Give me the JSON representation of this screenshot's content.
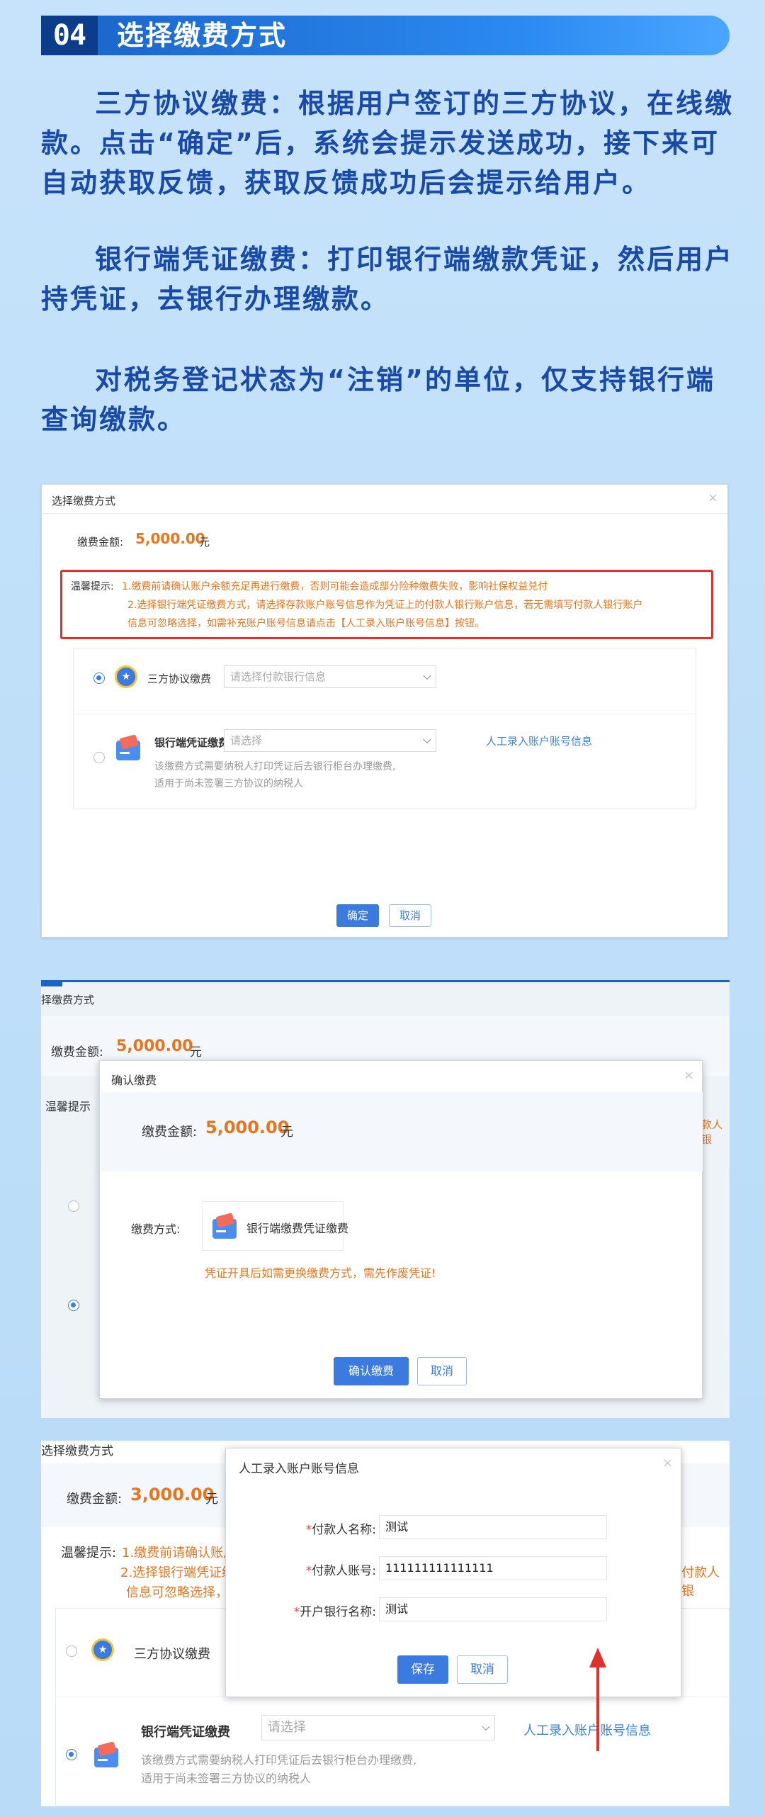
{
  "header": {
    "num": "04",
    "title": "选择缴费方式"
  },
  "paragraphs": [
    "三方协议缴费：根据用户签订的三方协议，在线缴款。点击“确定”后，系统会提示发送成功，接下来可自动获取反馈，获取反馈成功后会提示给用户。",
    "银行端凭证缴费：打印银行端缴款凭证，然后用户持凭证，去银行办理缴款。",
    "对税务登记状态为“注销”的单位，仅支持银行端查询缴款。"
  ],
  "shot1": {
    "title": "选择缴费方式",
    "amount_label": "缴费金额:",
    "amount": "5,000.00",
    "unit": "元",
    "tip_label": "温馨提示:",
    "tip1": "1.缴费前请确认账户余额充足再进行缴费，否则可能会造成部分险种缴费失败，影响社保权益兑付",
    "tip2": "2.选择银行端凭证缴费方式，请选择存款账户账号信息作为凭证上的付款人银行账户信息，若无需填写付款人银行账户",
    "tip3": "信息可忽略选择，如需补充账户账号信息请点击【人工录入账户账号信息】按钮。",
    "opt1_label": "三方协议缴费",
    "opt1_placeholder": "请选择付款银行信息",
    "opt2_label": "银行端凭证缴费",
    "opt2_placeholder": "请选择",
    "opt2_link": "人工录入账户账号信息",
    "opt2_desc1": "该缴费方式需要纳税人打印凭证后去银行柜台办理缴费,",
    "opt2_desc2": "适用于尚未签署三方协议的纳税人",
    "ok": "确定",
    "cancel": "取消"
  },
  "shot2": {
    "bg_title": "择缴费方式",
    "bg_amount_label": "缴费金额:",
    "bg_amount": "5,000.00",
    "bg_unit": "元",
    "bg_tip_label": "温馨提示",
    "bg_right": "款人银",
    "title": "确认缴费",
    "amount_label": "缴费金额:",
    "amount": "5,000.00",
    "unit": "元",
    "method_label": "缴费方式:",
    "method": "银行端缴费凭证缴费",
    "warning": "凭证开具后如需更换缴费方式，需先作废凭证!",
    "confirm": "确认缴费",
    "cancel": "取消"
  },
  "shot3": {
    "bg_title": "选择缴费方式",
    "bg_amount_label": "缴费金额:",
    "bg_amount": "3,000.00",
    "bg_unit": "元",
    "bg_tip_label": "温馨提示:",
    "bg_tip1": "1.缴费前请确认账户",
    "bg_tip2": "2.选择银行端凭证缴",
    "bg_tip3": "信息可忽略选择，",
    "bg_right": "付款人银",
    "bg_opt1": "三方协议缴费",
    "bg_opt2": "银行端凭证缴费",
    "bg_opt2_placeholder": "请选择",
    "bg_opt2_link": "人工录入账户账号信息",
    "bg_desc1": "该缴费方式需要纳税人打印凭证后去银行柜台办理缴费,",
    "bg_desc2": "适用于尚未签署三方协议的纳税人",
    "title": "人工录入账户账号信息",
    "f1_label": "付款人名称:",
    "f1_value": "测试",
    "f2_label": "付款人账号:",
    "f2_value": "111111111111111",
    "f3_label": "开户银行名称:",
    "f3_value": "测试",
    "required_mark": "*",
    "save": "保存",
    "cancel": "取消"
  }
}
